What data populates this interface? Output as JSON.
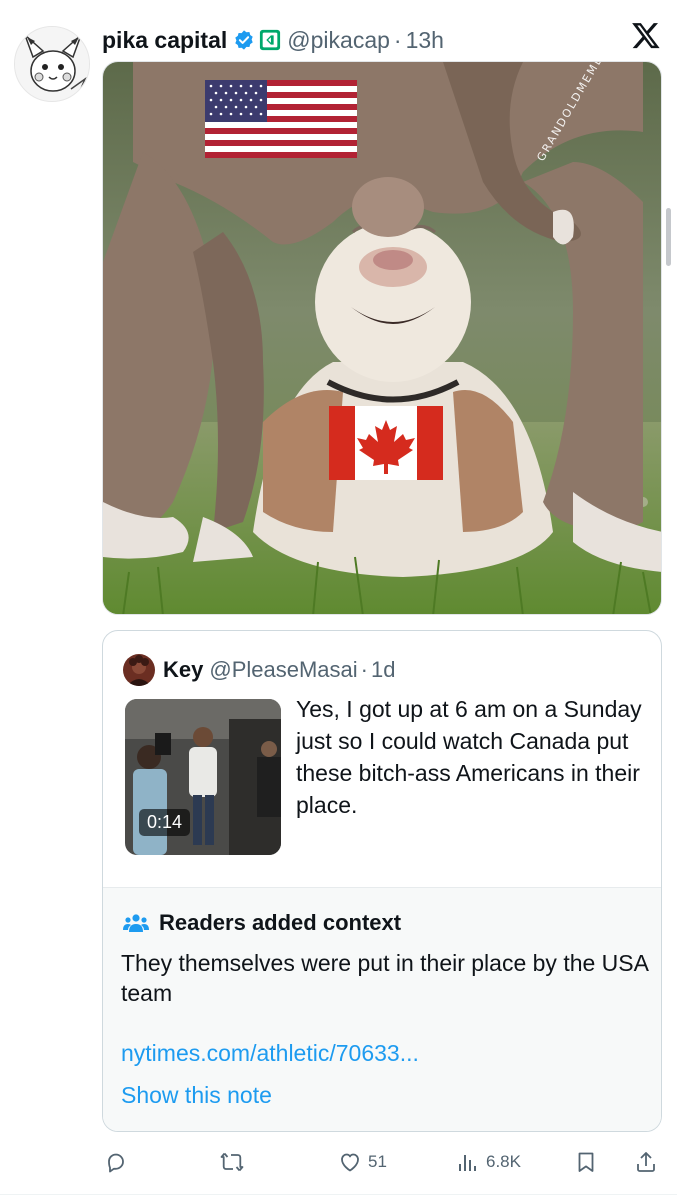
{
  "tweet": {
    "display_name": "pika capital",
    "handle": "@pikacap",
    "separator": "·",
    "time": "13h"
  },
  "quote": {
    "name": "Key",
    "handle": "@PleaseMasai",
    "separator": "·",
    "time": "1d",
    "video_duration": "0:14",
    "text": "Yes, I got up at 6 am on a Sunday just so I could watch Canada put these bitch-ass Americans in their place."
  },
  "context": {
    "title": "Readers added context",
    "body": "They themselves were put in their place by the USA team",
    "link": "nytimes.com/athletic/70633...",
    "show_note": "Show this note"
  },
  "actions": {
    "likes": "51",
    "views": "6.8K"
  },
  "photo": {
    "watermark": "GRANDOLDMEMES"
  },
  "icons": {
    "reply": "reply-icon",
    "repost": "repost-icon",
    "like": "heart-icon",
    "views": "views-icon",
    "bookmark": "bookmark-icon",
    "share": "share-icon",
    "verified": "verified-badge-icon",
    "affiliate": "affiliate-badge-icon",
    "platform": "x-logo-icon",
    "context": "people-icon"
  },
  "colors": {
    "verified": "#1d9bf0",
    "affiliate": "#00a86b",
    "link": "#1d9bf0",
    "muted": "#536471"
  }
}
